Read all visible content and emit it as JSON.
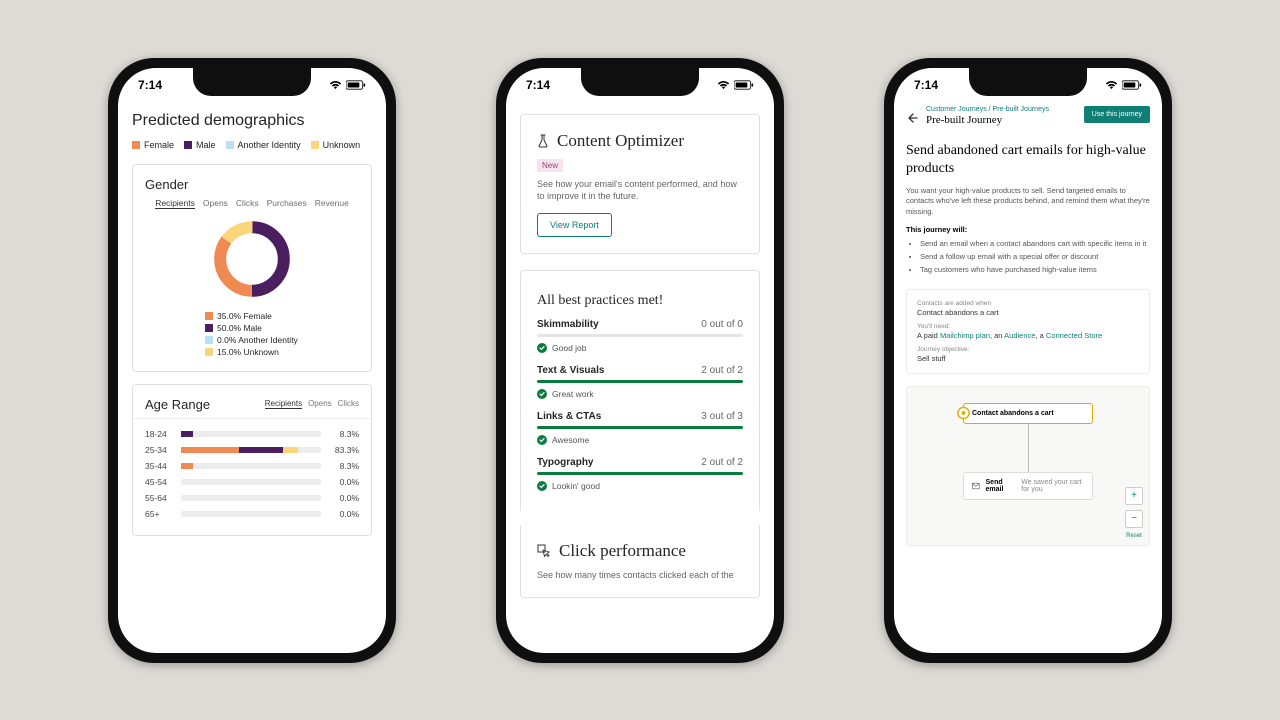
{
  "status": {
    "time": "7:14"
  },
  "phone1": {
    "title": "Predicted demographics",
    "legend": {
      "female": "Female",
      "male": "Male",
      "another": "Another Identity",
      "unknown": "Unknown"
    },
    "gender_card": {
      "title": "Gender",
      "tabs": [
        "Recipients",
        "Opens",
        "Clicks",
        "Purchases",
        "Revenue"
      ],
      "items": [
        {
          "label": "35.0% Female"
        },
        {
          "label": "50.0% Male"
        },
        {
          "label": "0.0% Another Identity"
        },
        {
          "label": "15.0% Unknown"
        }
      ]
    },
    "age_card": {
      "title": "Age Range",
      "tabs": [
        "Recipients",
        "Opens",
        "Clicks"
      ],
      "rows": [
        {
          "label": "18-24",
          "value": "8.3%"
        },
        {
          "label": "25-34",
          "value": "83.3%"
        },
        {
          "label": "35-44",
          "value": "8.3%"
        },
        {
          "label": "45-54",
          "value": "0.0%"
        },
        {
          "label": "55-64",
          "value": "0.0%"
        },
        {
          "label": "65+",
          "value": "0.0%"
        }
      ]
    }
  },
  "phone2": {
    "optimizer": {
      "title": "Content Optimizer",
      "badge": "New",
      "desc": "See how your email's content performed, and how to improve it in the future.",
      "button": "View Report"
    },
    "practices_title": "All best practices met!",
    "metrics": {
      "skim": {
        "label": "Skimmability",
        "score": "0 out of 0",
        "status": "Good job"
      },
      "text": {
        "label": "Text & Visuals",
        "score": "2 out of 2",
        "status": "Great work"
      },
      "links": {
        "label": "Links & CTAs",
        "score": "3 out of 3",
        "status": "Awesome"
      },
      "typo": {
        "label": "Typography",
        "score": "2 out of 2",
        "status": "Lookin' good"
      }
    },
    "click_perf": {
      "title": "Click performance",
      "desc": "See how many times contacts clicked each of the"
    }
  },
  "phone3": {
    "crumbs": {
      "a": "Customer Journeys",
      "sep": " / ",
      "b": "Pre-built Journeys"
    },
    "breadcrumb_title": "Pre-built Journey",
    "cta": "Use this journey",
    "headline": "Send abandoned cart emails for high-value products",
    "desc": "You want your high-value products to sell. Send targeted emails to contacts who've left these products behind, and remind them what they're missing.",
    "will_label": "This journey will:",
    "will": [
      "Send an email when a contact abandons cart with specific items in it",
      "Send a follow up email with a special offer or discount",
      "Tag customers who have purchased high-value items"
    ],
    "info": {
      "added_label": "Contacts are added when",
      "added_value": "Contact abandons a cart",
      "need_label": "You'll need:",
      "need_prefix": "A paid ",
      "need_link1": "Mailchimp plan",
      "need_mid1": ", an ",
      "need_link2": "Audience",
      "need_mid2": ", a ",
      "need_link3": "Connected Store",
      "obj_label": "Journey objective:",
      "obj_value": "Sell stuff"
    },
    "flow": {
      "start": "Contact abandons a cart",
      "email_label": "Send email",
      "email_sub": "We saved your cart for you",
      "reset": "Reset"
    }
  },
  "chart_data": [
    {
      "type": "pie",
      "title": "Gender",
      "series": [
        {
          "name": "Female",
          "value": 35.0,
          "color": "#ef8b52"
        },
        {
          "name": "Male",
          "value": 50.0,
          "color": "#4b1e5f"
        },
        {
          "name": "Another Identity",
          "value": 0.0,
          "color": "#b9dff1"
        },
        {
          "name": "Unknown",
          "value": 15.0,
          "color": "#f9d67a"
        }
      ]
    },
    {
      "type": "bar",
      "title": "Age Range",
      "categories": [
        "18-24",
        "25-34",
        "35-44",
        "45-54",
        "55-64",
        "65+"
      ],
      "values": [
        8.3,
        83.3,
        8.3,
        0.0,
        0.0,
        0.0
      ],
      "ylim": [
        0,
        100
      ]
    },
    {
      "type": "bar",
      "title": "Best practices",
      "categories": [
        "Skimmability",
        "Text & Visuals",
        "Links & CTAs",
        "Typography"
      ],
      "series": [
        {
          "name": "score",
          "values": [
            0,
            2,
            3,
            2
          ]
        },
        {
          "name": "max",
          "values": [
            0,
            2,
            3,
            2
          ]
        }
      ]
    }
  ]
}
